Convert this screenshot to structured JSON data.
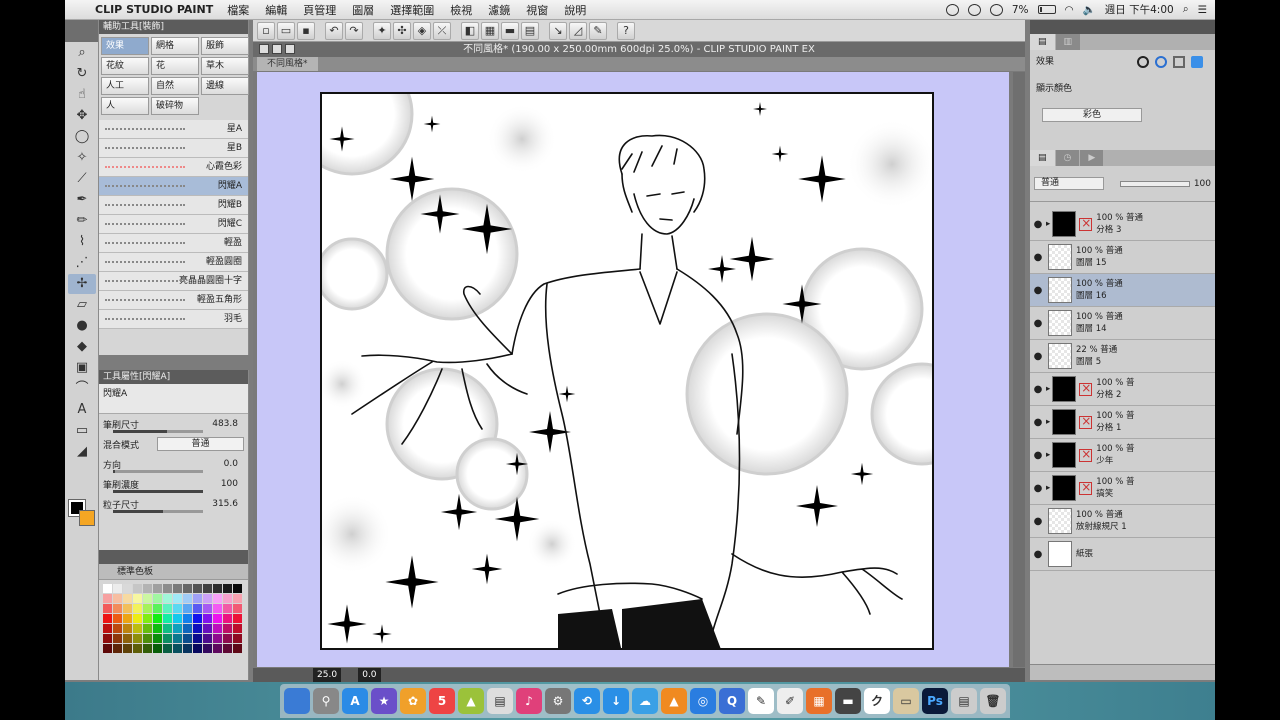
{
  "menubar": {
    "app": "CLIP STUDIO PAINT",
    "items": [
      "檔案",
      "編輯",
      "頁管理",
      "圖層",
      "選擇範圍",
      "檢視",
      "濾鏡",
      "視窗",
      "說明"
    ],
    "battery": "7%",
    "clock": "週日 下午4:00"
  },
  "window": {
    "title": "不同風格* (190.00 x 250.00mm 600dpi 25.0%)  - CLIP STUDIO PAINT EX",
    "doc_tab": "不同風格*"
  },
  "subtool": {
    "header": "輔助工具[裝飾]",
    "groups": [
      "效果",
      "網格",
      "服飾",
      "花紋",
      "花",
      "草木",
      "人工",
      "自然",
      "邊線",
      "人",
      "破碎物"
    ],
    "brushes": [
      "星A",
      "星B",
      "心霞色彩",
      "閃耀A",
      "閃耀B",
      "閃耀C",
      "輕盈",
      "輕盈圓圈",
      "亮晶晶圓圈十字",
      "輕盈五角形",
      "羽毛"
    ]
  },
  "toolprop": {
    "header": "工具屬性[閃耀A]",
    "preview_label": "閃耀A",
    "rows": [
      {
        "label": "筆刷尺寸",
        "value": "483.8"
      },
      {
        "label": "混合模式",
        "value": "普通"
      },
      {
        "label": "方向",
        "value": "0.0"
      },
      {
        "label": "筆刷濃度",
        "value": "100"
      },
      {
        "label": "粒子尺寸",
        "value": "315.6"
      }
    ]
  },
  "colorset": {
    "header": "標準色板"
  },
  "status": {
    "zoom": "25.0",
    "angle": "0.0"
  },
  "layerprop": {
    "effect_label": "效果",
    "display_color_label": "顯示顏色",
    "display_color_value": "彩色"
  },
  "layers": {
    "blend_mode": "普通",
    "opacity": "100",
    "items": [
      {
        "line1": "100 % 普通",
        "line2": "分格 3",
        "type": "folder",
        "selected": false
      },
      {
        "line1": "100 % 普通",
        "line2": "圖層 15",
        "type": "raster",
        "selected": false
      },
      {
        "line1": "100 % 普通",
        "line2": "圖層 16",
        "type": "raster",
        "selected": true
      },
      {
        "line1": "100 % 普通",
        "line2": "圖層 14",
        "type": "raster",
        "selected": false
      },
      {
        "line1": "22 % 普通",
        "line2": "圖層 5",
        "type": "raster",
        "selected": false
      },
      {
        "line1": "100 % 普",
        "line2": "分格 2",
        "type": "folder",
        "selected": false
      },
      {
        "line1": "100 % 普",
        "line2": "分格 1",
        "type": "folder",
        "selected": false
      },
      {
        "line1": "100 % 普",
        "line2": "少年",
        "type": "folder",
        "selected": false
      },
      {
        "line1": "100 % 普",
        "line2": "搞笑",
        "type": "folder",
        "selected": false
      },
      {
        "line1": "100 % 普通",
        "line2": "放射線規尺 1",
        "type": "raster",
        "selected": false
      },
      {
        "line1": "",
        "line2": "紙張",
        "type": "paper",
        "selected": false
      }
    ]
  }
}
